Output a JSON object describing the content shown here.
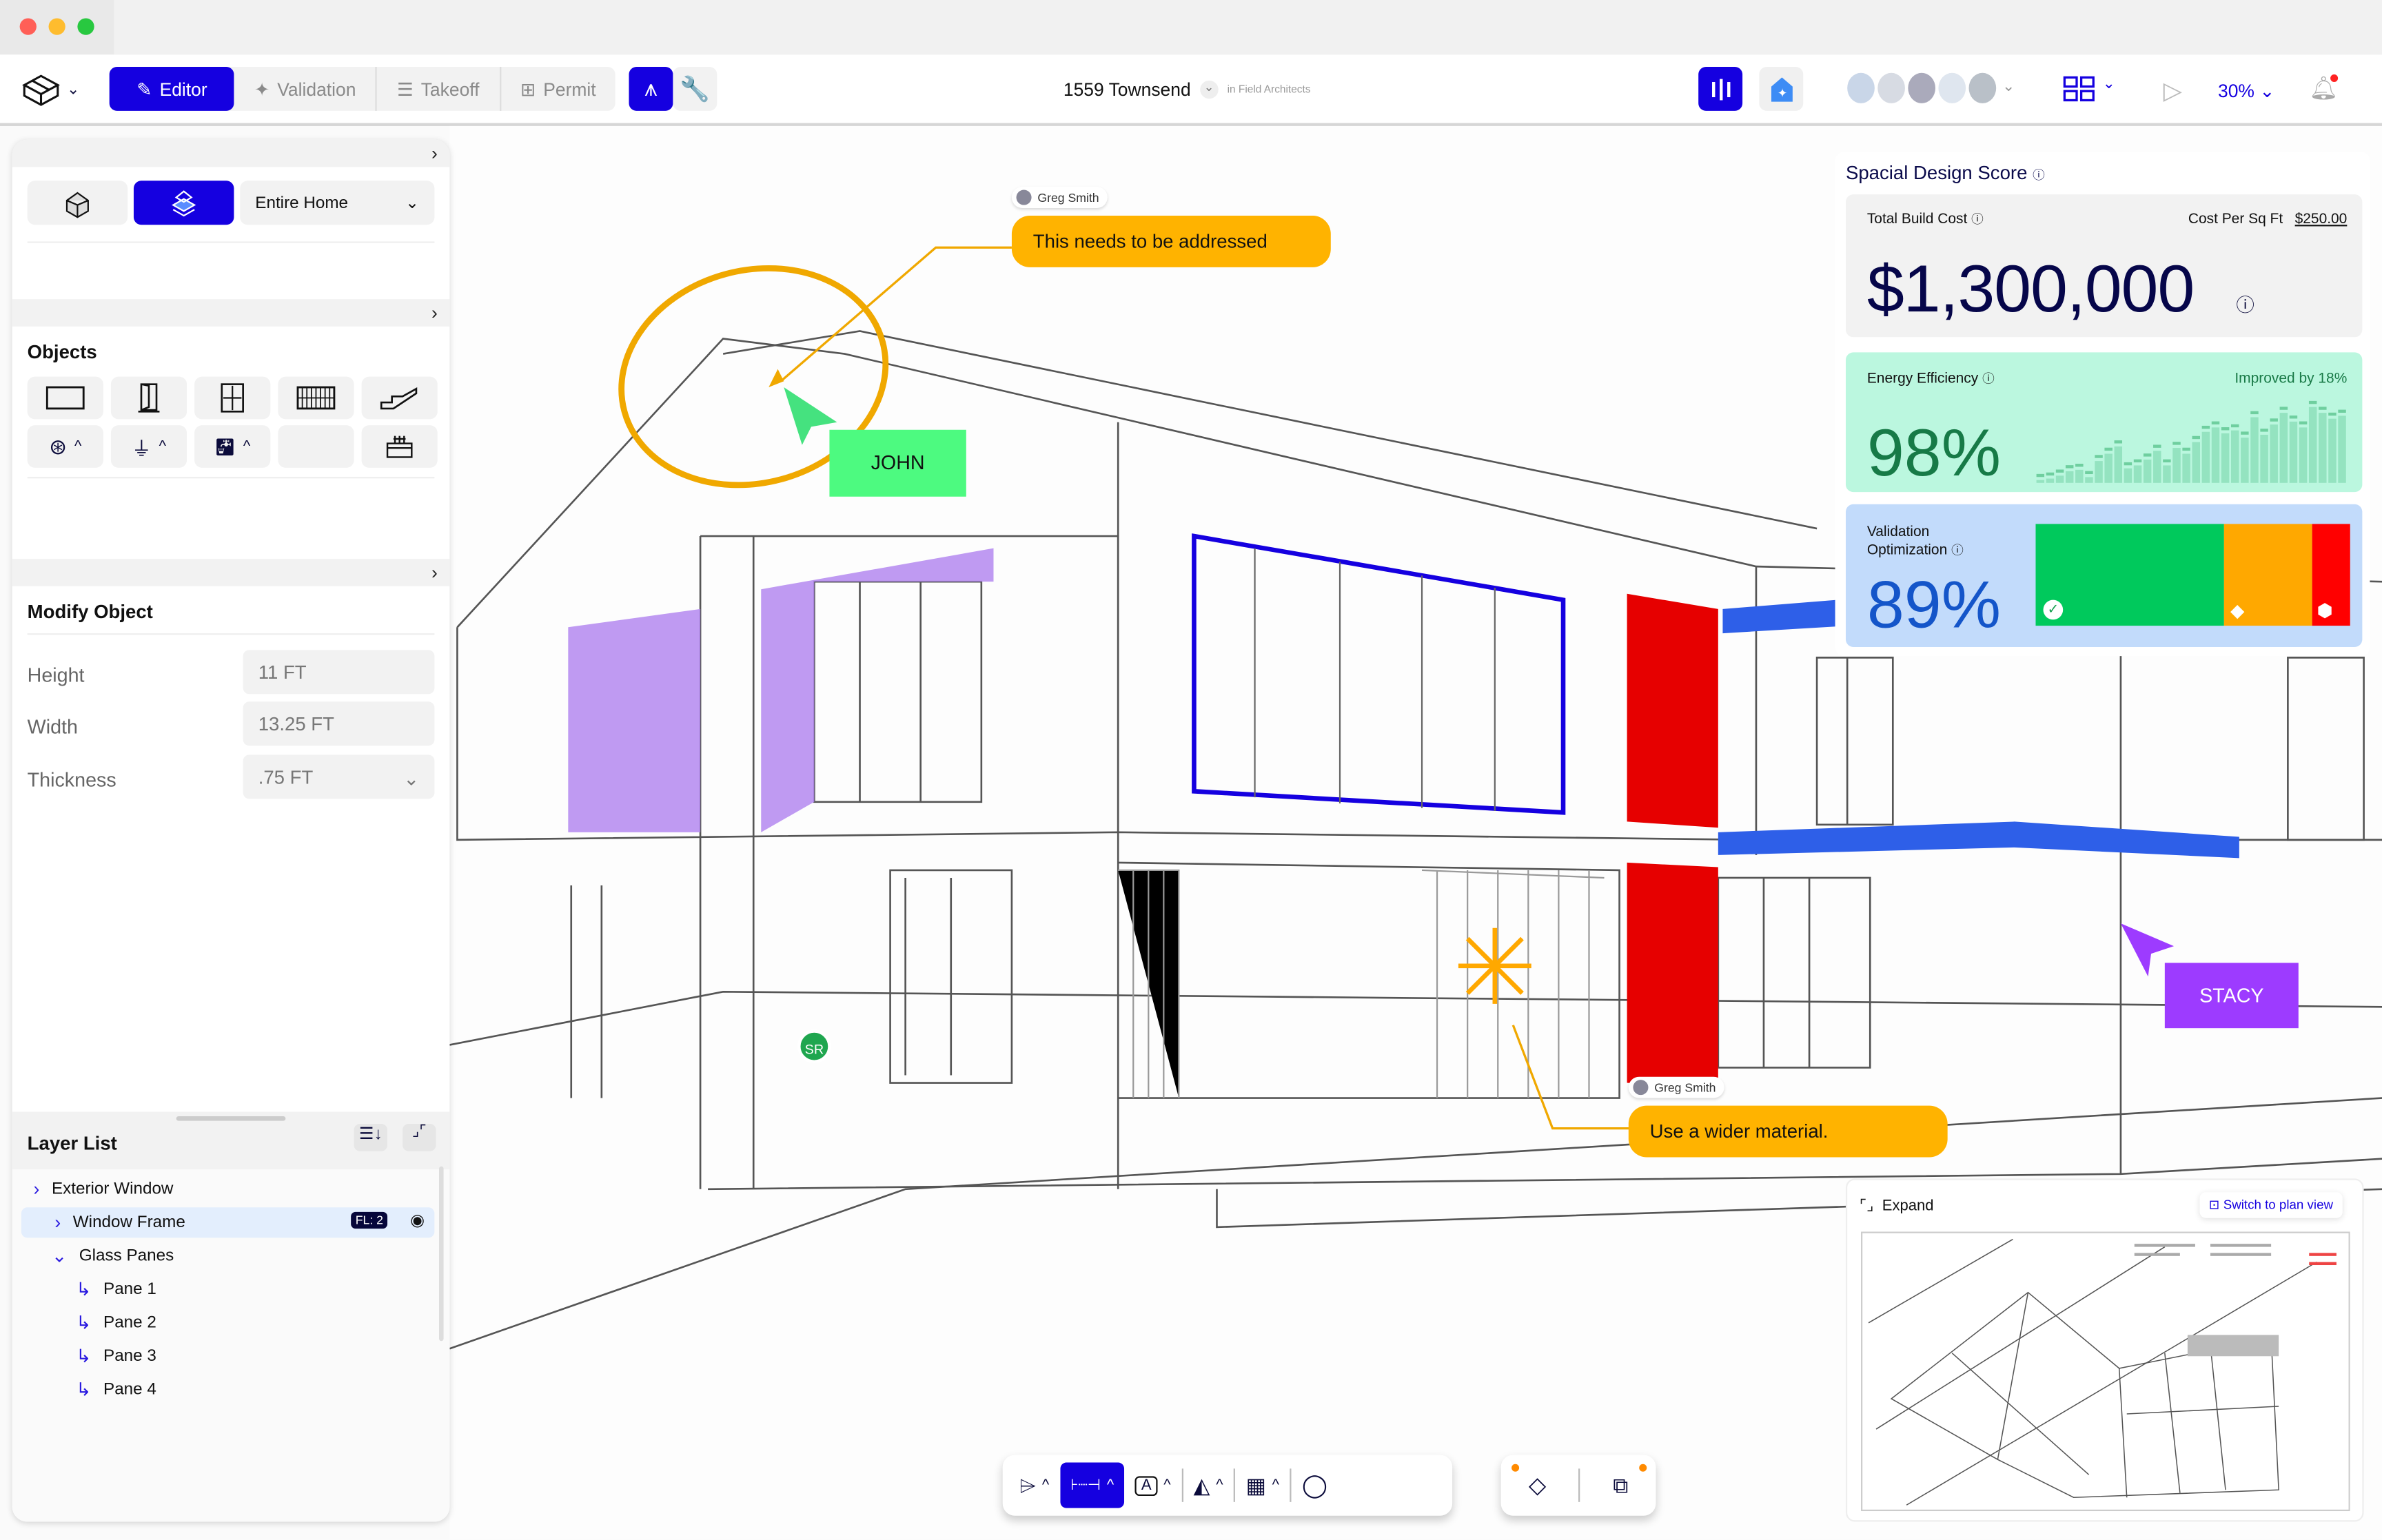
{
  "toolbar": {
    "modes": [
      {
        "label": "Editor",
        "icon": "pen-icon",
        "active": true
      },
      {
        "label": "Validation",
        "icon": "sparkle-icon"
      },
      {
        "label": "Takeoff",
        "icon": "list-icon"
      },
      {
        "label": "Permit",
        "icon": "document-icon"
      }
    ],
    "project_name": "1559 Townsend",
    "org": "in Field Architects",
    "zoom": "30%",
    "accent": "#1500e0"
  },
  "left_panel": {
    "scope": "Entire Home",
    "objects_title": "Objects",
    "objects": [
      "wall-icon",
      "door-icon",
      "window-icon",
      "curtain-wall-icon",
      "stairs-icon",
      "hvac-icon",
      "outlet-icon",
      "plumbing-icon",
      "empty",
      "appliance-icon"
    ],
    "modify_title": "Modify Object",
    "fields": [
      {
        "label": "Height",
        "value": "11 FT"
      },
      {
        "label": "Width",
        "value": "13.25 FT"
      },
      {
        "label": "Thickness",
        "value": ".75 FT"
      }
    ],
    "layer_title": "Layer List",
    "layers": [
      {
        "name": "Exterior Window",
        "level": 0,
        "chev": "›"
      },
      {
        "name": "Window Frame",
        "level": 1,
        "chev": "›",
        "badge": "FL: 2",
        "selected": true
      },
      {
        "name": "Glass Panes",
        "level": 1,
        "chev": "⌄"
      },
      {
        "name": "Pane 1",
        "level": 2
      },
      {
        "name": "Pane 2",
        "level": 2
      },
      {
        "name": "Pane 3",
        "level": 2
      },
      {
        "name": "Pane 4",
        "level": 2
      }
    ]
  },
  "annotations": {
    "comment1": {
      "author": "Greg Smith",
      "text": "This needs to be addressed"
    },
    "comment2": {
      "author": "Greg Smith",
      "text": "Use a wider material."
    },
    "cursor_john": "JOHN",
    "cursor_stacy": "STACY",
    "avatar_sr": "SR"
  },
  "score": {
    "title": "Spacial Design Score",
    "cost_label": "Total Build Cost",
    "sqft_label": "Cost Per Sq Ft",
    "sqft_value": "$250.00",
    "cost_value": "$1,300,000",
    "energy_label": "Energy Efficiency",
    "energy_value": "98%",
    "energy_change": "Improved by 18%",
    "energy_bars": [
      2,
      3,
      5,
      8,
      9,
      4,
      15,
      20,
      25,
      10,
      12,
      16,
      22,
      12,
      24,
      20,
      28,
      35,
      38,
      34,
      36,
      31,
      45,
      33,
      40,
      48,
      42,
      38,
      52,
      48,
      44,
      46
    ],
    "validation_label_1": "Validation",
    "validation_label_2": "Optimization",
    "validation_value": "89%",
    "validation_split": {
      "pass": 60,
      "warn": 28,
      "fail": 12
    },
    "colors": {
      "pass": "#00c95c",
      "warn": "#ffa800",
      "fail": "#ff0000"
    }
  },
  "minimap": {
    "expand_label": "Expand",
    "switch_label": "Switch to plan view"
  }
}
